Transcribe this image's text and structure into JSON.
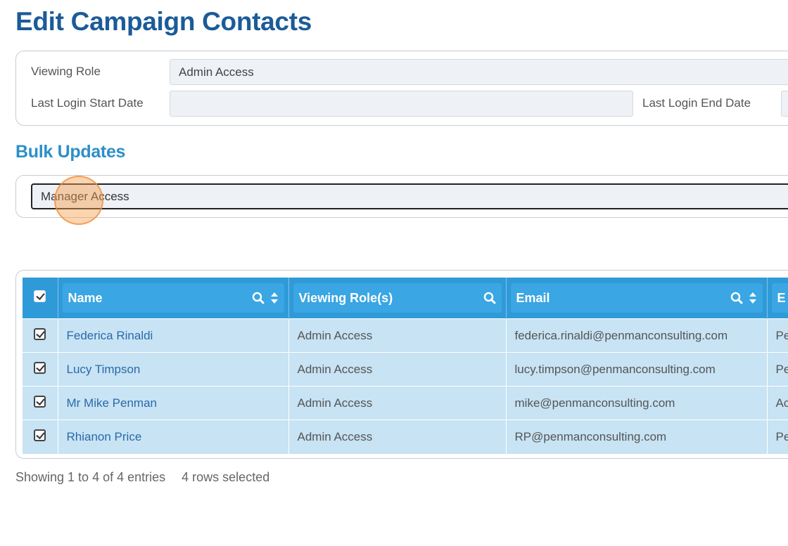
{
  "page": {
    "title": "Edit Campaign Contacts"
  },
  "filters": {
    "viewing_role_label": "Viewing Role",
    "viewing_role_value": "Admin Access",
    "last_login_start_label": "Last Login Start Date",
    "last_login_start_value": "",
    "last_login_end_label": "Last Login End Date",
    "last_login_end_value": ""
  },
  "bulk": {
    "title": "Bulk Updates",
    "selected_value": "Manager Access"
  },
  "table": {
    "columns": [
      "Name",
      "Viewing Role(s)",
      "Email",
      "E"
    ],
    "rows": [
      {
        "name": "Federica Rinaldi",
        "role": "Admin Access",
        "email": "federica.rinaldi@penmanconsulting.com",
        "extra": "Pe"
      },
      {
        "name": "Lucy Timpson",
        "role": "Admin Access",
        "email": "lucy.timpson@penmanconsulting.com",
        "extra": "Pe"
      },
      {
        "name": "Mr Mike Penman",
        "role": "Admin Access",
        "email": "mike@penmanconsulting.com",
        "extra": "Ac"
      },
      {
        "name": "Rhianon Price",
        "role": "Admin Access",
        "email": "RP@penmanconsulting.com",
        "extra": "Pe"
      }
    ]
  },
  "footer": {
    "entries": "Showing 1 to 4 of 4 entries",
    "selected": "4 rows selected"
  },
  "icons": {
    "search": "search-icon",
    "sort": "sort-icon",
    "checkbox": "checkbox-checked-icon"
  },
  "colors": {
    "title": "#1b5b98",
    "section_title": "#2c8fc7",
    "table_header": "#2f9ad8",
    "row_bg": "#c7e3f4",
    "link": "#2b6aa8"
  }
}
